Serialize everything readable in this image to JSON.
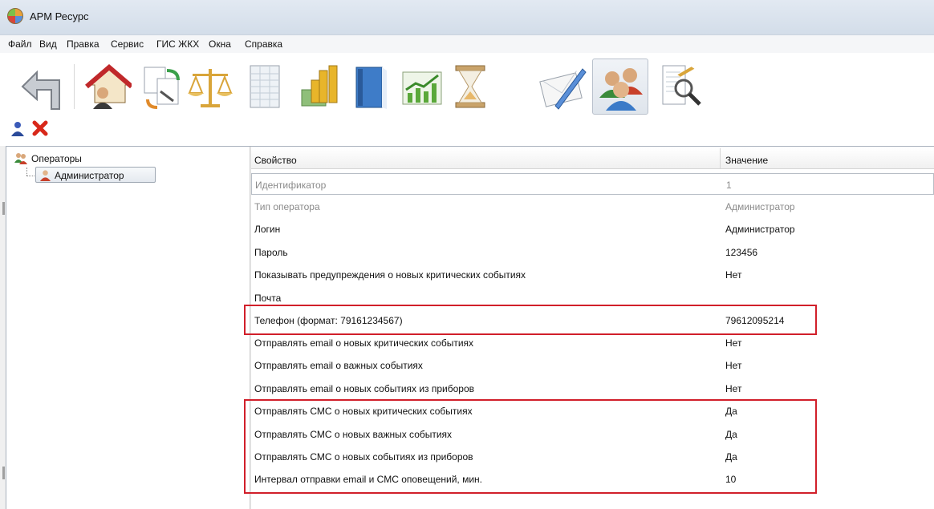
{
  "window": {
    "title": "АРМ Ресурс"
  },
  "menu": [
    "Файл",
    "Вид",
    "Правка",
    "Сервис",
    "ГИС ЖКХ",
    "Окна",
    "Справка"
  ],
  "toolbar": {
    "icons": [
      "back-arrow-icon",
      "house-user-icon",
      "documents-sync-icon",
      "scales-icon",
      "spreadsheet-icon",
      "coins-money-icon",
      "blue-book-icon",
      "growth-chart-icon",
      "hourglass-icon",
      "envelope-pen-icon",
      "users-group-icon",
      "document-magnifier-icon"
    ],
    "active": "users-group-icon",
    "small": [
      "add-user-icon",
      "delete-icon"
    ]
  },
  "tree": {
    "root_label": "Операторы",
    "child_label": "Администратор"
  },
  "grid": {
    "columns": [
      "Свойство",
      "Значение"
    ],
    "rows": [
      {
        "property": "Идентификатор",
        "value": "1"
      },
      {
        "property": "Тип оператора",
        "value": "Администратор"
      },
      {
        "property": "Логин",
        "value": "Администратор"
      },
      {
        "property": "Пароль",
        "value": "123456"
      },
      {
        "property": "Показывать предупреждения о новых критических событиях",
        "value": "Нет"
      },
      {
        "property": "Почта",
        "value": ""
      },
      {
        "property": "Телефон (формат: 79161234567)",
        "value": "79612095214"
      },
      {
        "property": "Отправлять email о новых критических событиях",
        "value": "Нет"
      },
      {
        "property": "Отправлять email о важных событиях",
        "value": "Нет"
      },
      {
        "property": "Отправлять email о новых событиях из приборов",
        "value": "Нет"
      },
      {
        "property": "Отправлять СМС о новых критических событиях",
        "value": "Да"
      },
      {
        "property": "Отправлять СМС о новых важных событиях",
        "value": "Да"
      },
      {
        "property": "Отправлять СМС о новых событиях из приборов",
        "value": "Да"
      },
      {
        "property": "Интервал отправки email и СМС оповещений, мин.",
        "value": "10"
      }
    ]
  },
  "colors": {
    "highlight": "#d11f2a",
    "readonly_text": "#8a8a8a"
  }
}
